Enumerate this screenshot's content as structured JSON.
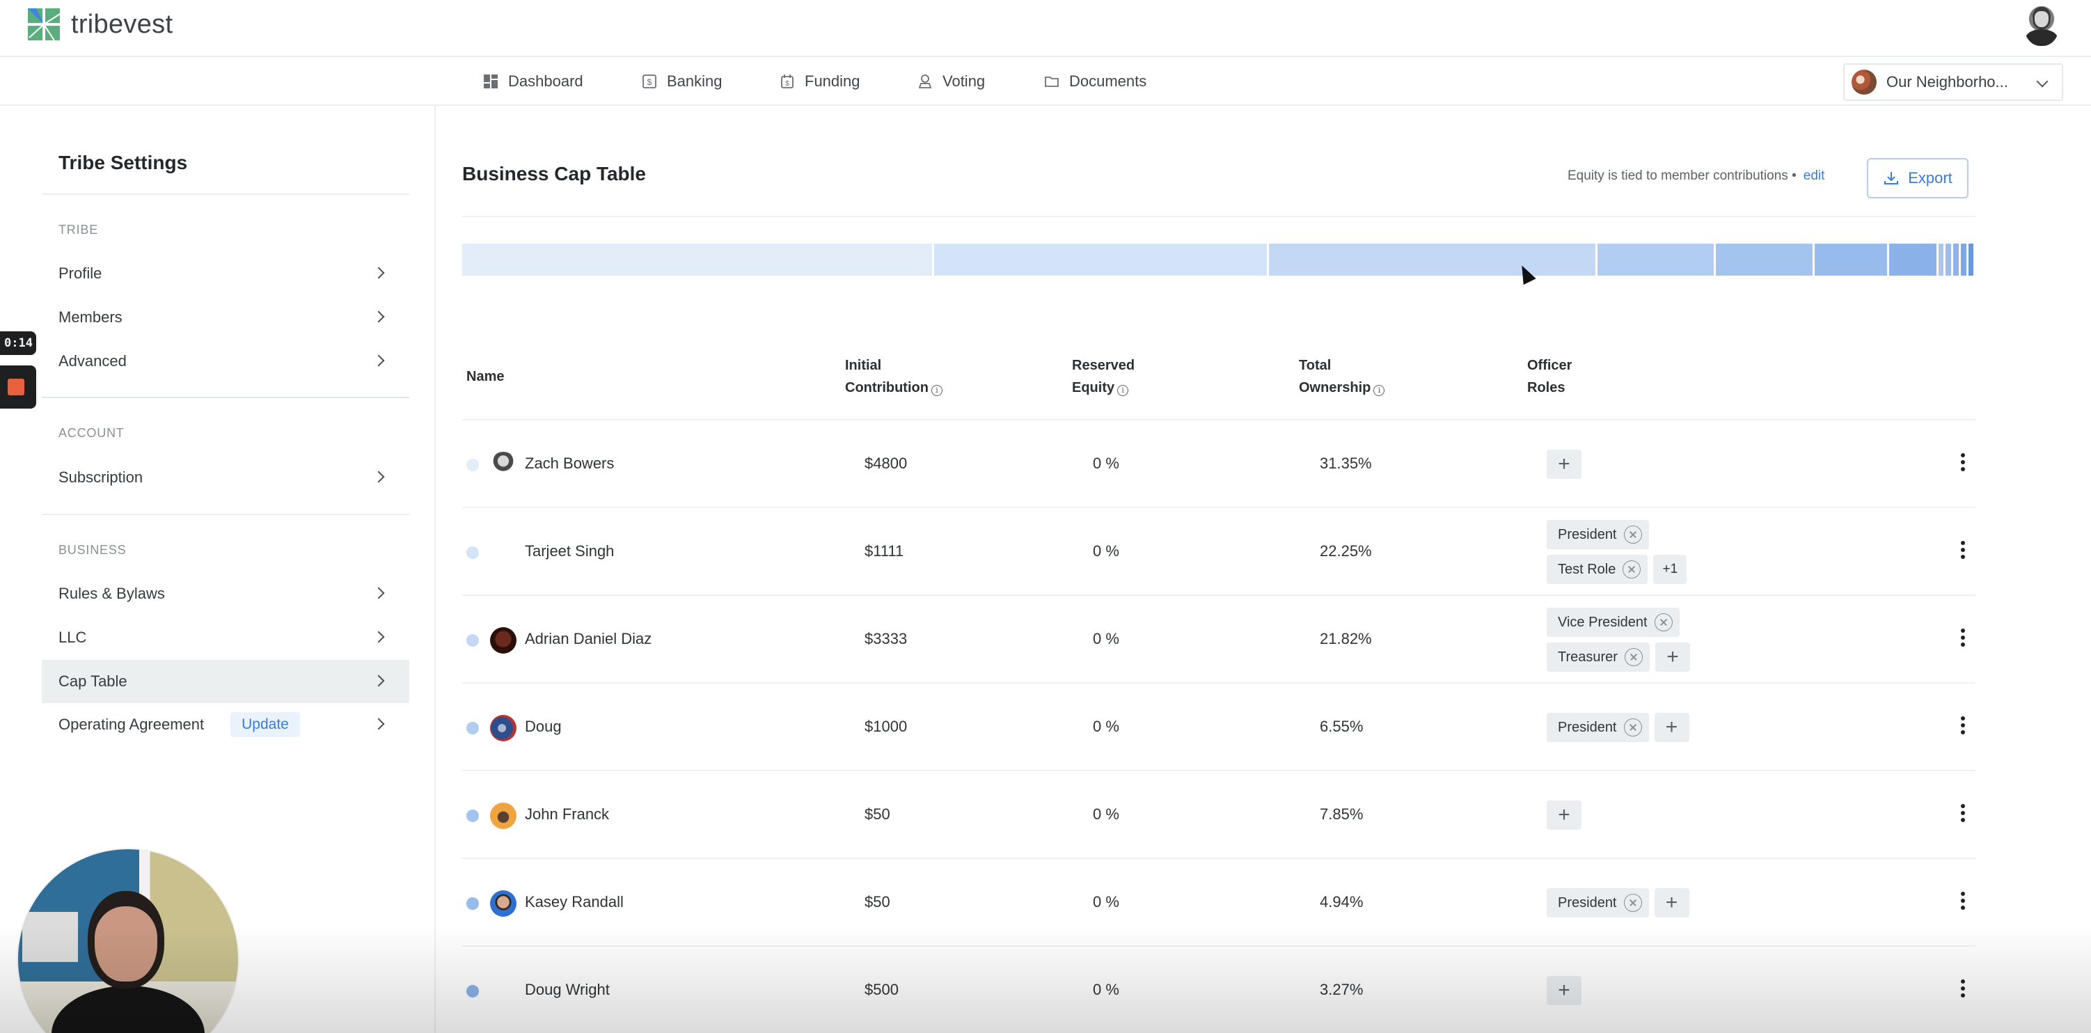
{
  "app": {
    "name": "tribevest"
  },
  "nav": {
    "items": [
      {
        "label": "Dashboard",
        "icon": "dashboard-icon"
      },
      {
        "label": "Banking",
        "icon": "banking-icon"
      },
      {
        "label": "Funding",
        "icon": "funding-icon"
      },
      {
        "label": "Voting",
        "icon": "voting-icon"
      },
      {
        "label": "Documents",
        "icon": "folder-icon"
      }
    ],
    "tribe_selector": "Our Neighborho..."
  },
  "recording": {
    "timer": "0:14"
  },
  "sidebar": {
    "title": "Tribe Settings",
    "sections": [
      {
        "label": "TRIBE",
        "items": [
          {
            "label": "Profile"
          },
          {
            "label": "Members"
          },
          {
            "label": "Advanced"
          }
        ]
      },
      {
        "label": "ACCOUNT",
        "items": [
          {
            "label": "Subscription"
          }
        ]
      },
      {
        "label": "BUSINESS",
        "items": [
          {
            "label": "Rules & Bylaws"
          },
          {
            "label": "LLC"
          },
          {
            "label": "Cap Table",
            "active": true
          },
          {
            "label": "Operating Agreement",
            "badge": "Update"
          }
        ]
      }
    ]
  },
  "main": {
    "title": "Business Cap Table",
    "equity_note": "Equity is tied to member contributions •",
    "edit_label": "edit",
    "export_label": "Export",
    "ownership_bar": [
      {
        "member": "Zach Bowers",
        "percent": 31.35,
        "color": "#e3edfa"
      },
      {
        "member": "Tarjeet Singh",
        "percent": 22.25,
        "color": "#d3e3f8"
      },
      {
        "member": "Adrian Daniel Diaz",
        "percent": 21.82,
        "color": "#c2d8f5"
      },
      {
        "member": "John Franck",
        "percent": 7.85,
        "color": "#b1cdf2"
      },
      {
        "member": "Doug",
        "percent": 6.55,
        "color": "#a3c4ef"
      },
      {
        "member": "Kasey Randall",
        "percent": 4.94,
        "color": "#96bbec"
      },
      {
        "member": "Doug Wright",
        "percent": 3.27,
        "color": "#8ab2e9"
      },
      {
        "member": "other-1",
        "percent": 0.5,
        "color": "#a9c6ef"
      },
      {
        "member": "other-2",
        "percent": 0.5,
        "color": "#9dbdec"
      },
      {
        "member": "other-3",
        "percent": 0.5,
        "color": "#8fb3e8"
      },
      {
        "member": "other-4",
        "percent": 0.5,
        "color": "#7ea8e4"
      },
      {
        "member": "other-5",
        "percent": 0.47,
        "color": "#6b97d8"
      }
    ],
    "columns": {
      "name": "Name",
      "initial_contribution": [
        "Initial",
        "Contribution"
      ],
      "reserved_equity": [
        "Reserved",
        "Equity"
      ],
      "total_ownership": [
        "Total",
        "Ownership"
      ],
      "officer_roles": [
        "Officer",
        "Roles"
      ]
    },
    "rows": [
      {
        "name": "Zach Bowers",
        "contribution": "$4800",
        "reserved": "0 %",
        "total": "31.35%",
        "dot_color": "#e3edfa",
        "avatar": "photo-bw",
        "roles": [],
        "role_extra": "add"
      },
      {
        "name": "Tarjeet Singh",
        "contribution": "$1111",
        "reserved": "0 %",
        "total": "22.25%",
        "dot_color": "#d3e3f8",
        "avatar": "none",
        "roles": [
          "President",
          "Test Role"
        ],
        "role_extra": "+1"
      },
      {
        "name": "Adrian Daniel Diaz",
        "contribution": "$3333",
        "reserved": "0 %",
        "total": "21.82%",
        "dot_color": "#c2d8f5",
        "avatar": "photo-dark",
        "roles": [
          "Vice President",
          "Treasurer"
        ],
        "role_extra": "add"
      },
      {
        "name": "Doug",
        "contribution": "$1000",
        "reserved": "0 %",
        "total": "6.55%",
        "dot_color": "#b1cdf2",
        "avatar": "photo-blue-red",
        "roles": [
          "President"
        ],
        "role_extra": "add"
      },
      {
        "name": "John Franck",
        "contribution": "$50",
        "reserved": "0 %",
        "total": "7.85%",
        "dot_color": "#a3c4ef",
        "avatar": "photo-orange",
        "roles": [],
        "role_extra": "add"
      },
      {
        "name": "Kasey Randall",
        "contribution": "$50",
        "reserved": "0 %",
        "total": "4.94%",
        "dot_color": "#96bbec",
        "avatar": "photo-blue",
        "roles": [
          "President"
        ],
        "role_extra": "add"
      },
      {
        "name": "Doug Wright",
        "contribution": "$500",
        "reserved": "0 %",
        "total": "3.27%",
        "dot_color": "#8ab2e9",
        "avatar": "none",
        "roles": [],
        "role_extra": "add"
      }
    ]
  },
  "colors": {
    "accent": "#3a7bd5",
    "active_bg": "#eceff0",
    "chip_bg": "#eaeef0"
  }
}
